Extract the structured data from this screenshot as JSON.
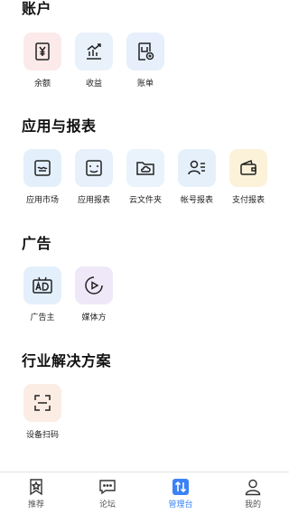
{
  "sections": {
    "account": {
      "title": "账户",
      "items": [
        {
          "label": "余额",
          "icon": "wallet-yen-icon",
          "bg": "#fce9ea",
          "stroke": "#222222"
        },
        {
          "label": "收益",
          "icon": "earnings-chart-icon",
          "bg": "#e9f1fb",
          "stroke": "#222222"
        },
        {
          "label": "账单",
          "icon": "bill-icon",
          "bg": "#e6effb",
          "stroke": "#222222"
        }
      ]
    },
    "apps": {
      "title": "应用与报表",
      "items": [
        {
          "label": "应用市场",
          "icon": "app-market-icon",
          "bg": "#e3f0fc",
          "stroke": "#222222"
        },
        {
          "label": "应用报表",
          "icon": "app-report-icon",
          "bg": "#e7f0fb",
          "stroke": "#222222"
        },
        {
          "label": "云文件夹",
          "icon": "cloud-folder-icon",
          "bg": "#eaf3fb",
          "stroke": "#222222"
        },
        {
          "label": "帐号报表",
          "icon": "account-report-icon",
          "bg": "#e6f0fb",
          "stroke": "#222222"
        },
        {
          "label": "支付报表",
          "icon": "payment-report-icon",
          "bg": "#fcf2d9",
          "stroke": "#222222"
        }
      ]
    },
    "ads": {
      "title": "广告",
      "items": [
        {
          "label": "广告主",
          "icon": "ad-icon",
          "bg": "#e3f0fc",
          "stroke": "#222222"
        },
        {
          "label": "媒体方",
          "icon": "media-play-icon",
          "bg": "#efe8f8",
          "stroke": "#222222"
        }
      ]
    },
    "industry": {
      "title": "行业解决方案",
      "items": [
        {
          "label": "设备扫码",
          "icon": "scan-icon",
          "bg": "#fbede3",
          "stroke": "#222222"
        }
      ]
    }
  },
  "tabbar": {
    "active_color": "#3b82f6",
    "tabs": [
      {
        "label": "推荐",
        "icon": "star-bookmark-icon",
        "active": false
      },
      {
        "label": "论坛",
        "icon": "chat-bubble-icon",
        "active": false
      },
      {
        "label": "管理台",
        "icon": "manage-console-icon",
        "active": true
      },
      {
        "label": "我的",
        "icon": "profile-icon",
        "active": false
      }
    ]
  }
}
